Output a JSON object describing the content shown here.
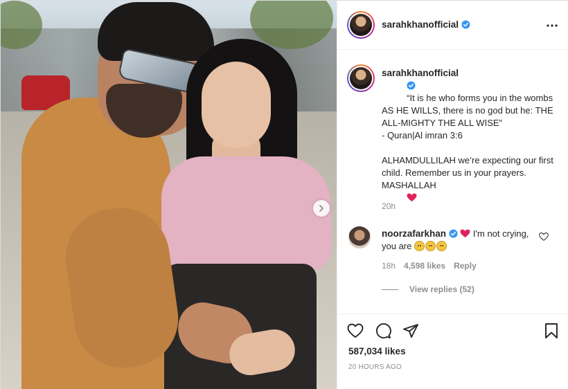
{
  "post": {
    "username": "sarahkhanofficial",
    "verified": true,
    "caption_lines": [
      "“It is he who forms you in the wombs AS HE WILLS, there is no god but he: THE ALL-MIGHTY THE ALL WISE”",
      "- Quran|Al imran 3:6",
      "",
      "ALHAMDULLILAH we’re expecting our first child. Remember us in your prayers.",
      "MASHALLAH"
    ],
    "caption_time": "20h",
    "likes": "587,034 likes",
    "timestamp": "20 HOURS AGO"
  },
  "comment": {
    "username": "noorzafarkhan",
    "verified": true,
    "text_part1": "I'm not crying, you are",
    "time": "18h",
    "likes": "4,598 likes",
    "reply_label": "Reply",
    "view_replies": "View replies (52)"
  },
  "icons": {
    "more": "more-options-icon",
    "like": "heart-icon",
    "comment": "comment-icon",
    "share": "share-icon",
    "save": "bookmark-icon",
    "next": "chevron-right-icon"
  },
  "colors": {
    "verified": "#3897f0",
    "heart_emoji": "#e0245e",
    "muted": "#8e8e8e",
    "text": "#262626"
  }
}
